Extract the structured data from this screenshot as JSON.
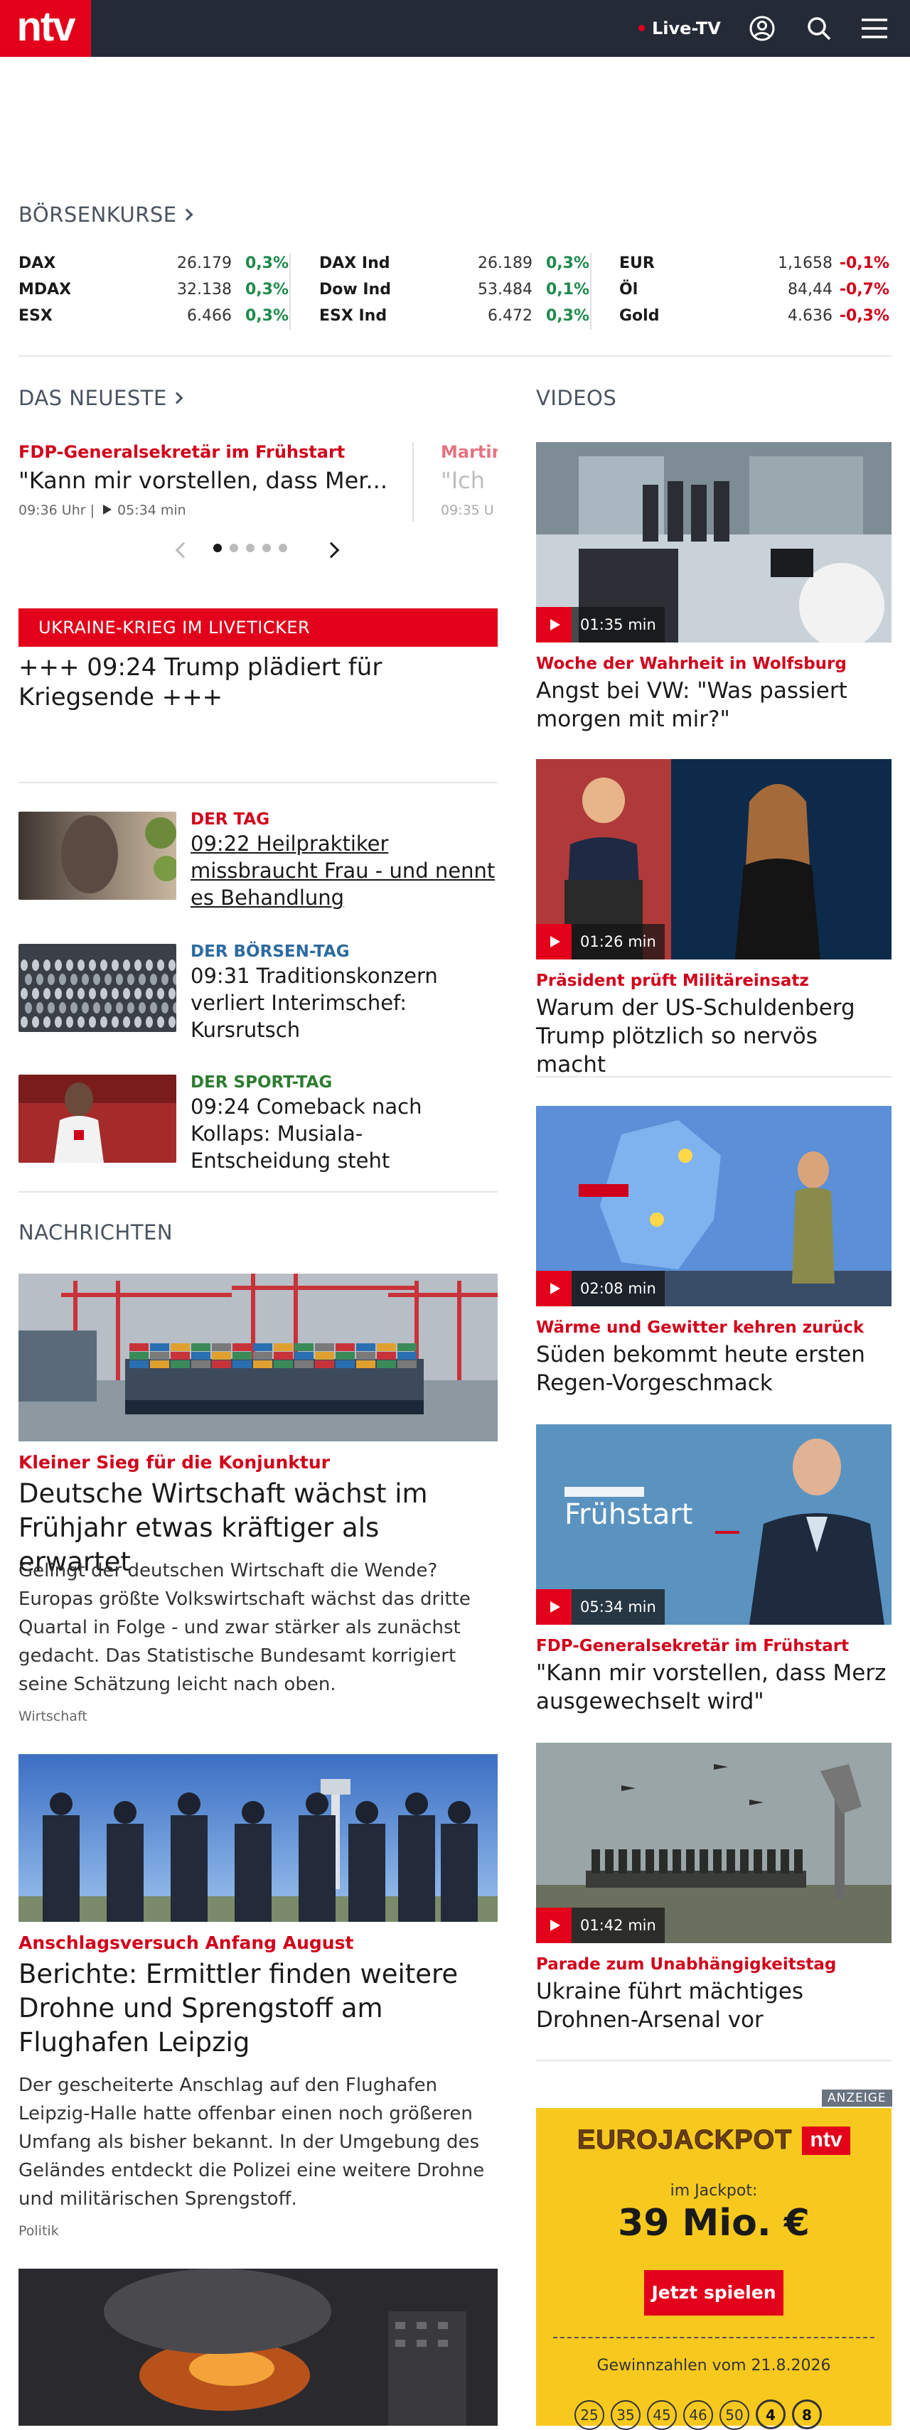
{
  "header": {
    "logo": "ntv",
    "live_label": "Live-TV"
  },
  "boerse": {
    "heading": "BÖRSENKURSE",
    "cols": [
      [
        {
          "name": "DAX",
          "value": "26.179",
          "change": "0,3%",
          "dir": "up"
        },
        {
          "name": "MDAX",
          "value": "32.138",
          "change": "0,3%",
          "dir": "up"
        },
        {
          "name": "ESX",
          "value": "6.466",
          "change": "0,3%",
          "dir": "up"
        }
      ],
      [
        {
          "name": "DAX Ind",
          "value": "26.189",
          "change": "0,3%",
          "dir": "up"
        },
        {
          "name": "Dow Ind",
          "value": "53.484",
          "change": "0,1%",
          "dir": "up"
        },
        {
          "name": "ESX Ind",
          "value": "6.472",
          "change": "0,3%",
          "dir": "up"
        }
      ],
      [
        {
          "name": "EUR",
          "value": "1,1658",
          "change": "-0,1%",
          "dir": "dn"
        },
        {
          "name": "Öl",
          "value": "84,44",
          "change": "-0,7%",
          "dir": "dn"
        },
        {
          "name": "Gold",
          "value": "4.636",
          "change": "-0,3%",
          "dir": "dn"
        }
      ]
    ]
  },
  "neueste": {
    "heading": "DAS NEUESTE",
    "slides": [
      {
        "kicker": "FDP-Generalsekretär im Frühstart",
        "title": "\"Kann mir vorstellen, dass Mer...",
        "time": "09:36 Uhr |",
        "duration": "05:34 min"
      },
      {
        "kicker": "Martin",
        "title": "\"Ich",
        "time": "09:35 U"
      }
    ]
  },
  "ukraine": {
    "bar": "UKRAINE-KRIEG IM LIVETICKER",
    "text": "+++ 09:24 Trump plädiert für Kriegsende +++"
  },
  "ticker": [
    {
      "kicker": "DER TAG",
      "kcolor": "#d0021b",
      "title": "09:22 Heilpraktiker missbraucht Frau - und nennt es Behandlung"
    },
    {
      "kicker": "DER BÖRSEN-TAG",
      "kcolor": "#2c6ba0",
      "title": "09:31 Traditionskonzern verliert Interimschef: Kursrutsch"
    },
    {
      "kicker": "DER SPORT-TAG",
      "kcolor": "#2e7d32",
      "title": "09:24 Comeback nach Kollaps: Musiala-Entscheidung steht"
    }
  ],
  "nachrichten": {
    "heading": "NACHRICHTEN",
    "items": [
      {
        "kicker": "Kleiner Sieg für die Konjunktur",
        "title": "Deutsche Wirtschaft wächst im Frühjahr etwas kräftiger als erwartet",
        "teaser": "Gelingt der deutschen Wirtschaft die Wende? Europas größte Volkswirtschaft wächst das dritte Quartal in Folge - und zwar stärker als zunächst gedacht. Das Statistische Bundesamt korrigiert seine Schätzung leicht nach oben.",
        "category": "Wirtschaft"
      },
      {
        "kicker": "Anschlagsversuch Anfang August",
        "title": "Berichte: Ermittler finden weitere Drohne und Sprengstoff am Flughafen Leipzig",
        "teaser": "Der gescheiterte Anschlag auf den Flughafen Leipzig-Halle hatte offenbar einen noch größeren Umfang als bisher bekannt. In der Umgebung des Geländes entdeckt die Polizei eine weitere Drohne und militärischen Sprengstoff.",
        "category": "Politik"
      }
    ]
  },
  "videos": {
    "heading": "VIDEOS",
    "items": [
      {
        "duration": "01:35 min",
        "kicker": "Woche der Wahrheit in Wolfsburg",
        "title": "Angst bei VW: \"Was passiert morgen mit mir?\""
      },
      {
        "duration": "01:26 min",
        "kicker": "Präsident prüft Militäreinsatz",
        "title": "Warum der US-Schuldenberg Trump plötzlich so nervös macht"
      },
      {
        "duration": "02:08 min",
        "kicker": "Wärme und Gewitter kehren zurück",
        "title": "Süden bekommt heute ersten Regen-Vorgeschmack"
      },
      {
        "duration": "05:34 min",
        "kicker": "FDP-Generalsekretär im Frühstart",
        "title": "\"Kann mir vorstellen, dass Merz ausgewechselt wird\""
      },
      {
        "duration": "01:42 min",
        "kicker": "Parade zum Unabhängigkeitstag",
        "title": "Ukraine führt mächtiges Drohnen-Arsenal vor"
      }
    ]
  },
  "ad": {
    "label": "ANZEIGE",
    "logo": "EUROJACKPOT",
    "ntv": "ntv",
    "jackpot_label": "im Jackpot:",
    "amount": "39 Mio. €",
    "button": "Jetzt spielen",
    "numbers_label": "Gewinnzahlen vom 21.8.2026",
    "numbers": [
      "25",
      "35",
      "45",
      "46",
      "50"
    ],
    "euro_numbers": [
      "4",
      "8"
    ]
  }
}
